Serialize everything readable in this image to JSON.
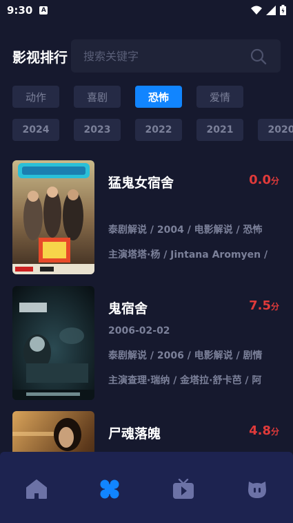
{
  "status_bar": {
    "time": "9:30",
    "notification_glyph": "A"
  },
  "header": {
    "title": "影视排行",
    "search_placeholder": "搜索关键字"
  },
  "genre_tabs": [
    {
      "label": "动作",
      "active": false
    },
    {
      "label": "喜剧",
      "active": false
    },
    {
      "label": "恐怖",
      "active": true
    },
    {
      "label": "爱情",
      "active": false
    }
  ],
  "year_tabs": [
    "2024",
    "2023",
    "2022",
    "2021",
    "2020"
  ],
  "movies": [
    {
      "title": "猛鬼女宿舍",
      "rating": "0.0",
      "rating_unit": "分",
      "date": "",
      "tags": "泰剧解说 / 2004 / 电影解说 / 恐怖",
      "cast": "主演塔塔·杨 / Jintana Aromyen /"
    },
    {
      "title": "鬼宿舍",
      "rating": "7.5",
      "rating_unit": "分",
      "date": "2006-02-02",
      "tags": "泰剧解说 / 2006 / 电影解说 / 剧情",
      "cast": "主演查理·瑞纳 / 金塔拉·舒卡芭 / 阿"
    },
    {
      "title": "尸魂落魄",
      "rating": "4.8",
      "rating_unit": "分",
      "date": "",
      "tags": "",
      "cast": ""
    }
  ],
  "bottom_nav": [
    {
      "icon": "home-icon",
      "active": false
    },
    {
      "icon": "category-icon",
      "active": true
    },
    {
      "icon": "tv-icon",
      "active": false
    },
    {
      "icon": "profile-icon",
      "active": false
    }
  ],
  "colors": {
    "background": "#16192e",
    "accent": "#1185ff",
    "rating": "#e03a3a",
    "tab_bar": "#1d2350"
  }
}
